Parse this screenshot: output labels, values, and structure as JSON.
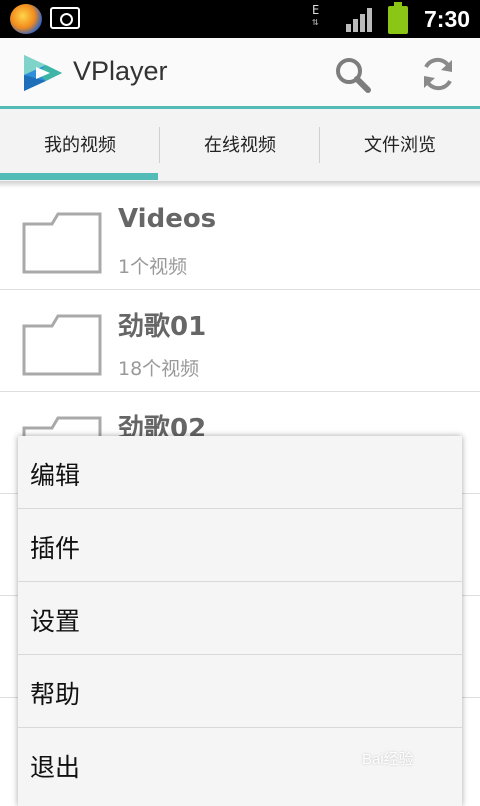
{
  "status_bar": {
    "network_type": "E",
    "time": "7:30",
    "signal_level": 4,
    "battery_level": 1.0,
    "icons": [
      "app-notification-icon",
      "camera-icon",
      "data-transfer-icon",
      "signal-icon",
      "battery-icon"
    ]
  },
  "action_bar": {
    "title": "VPlayer",
    "search_icon": "search-icon",
    "refresh_icon": "refresh-icon",
    "accent_color": "#53bcb6"
  },
  "tabs": [
    {
      "label": "我的视频",
      "selected": true
    },
    {
      "label": "在线视频",
      "selected": false
    },
    {
      "label": "文件浏览",
      "selected": false
    }
  ],
  "folders": [
    {
      "name": "Videos",
      "count": "1个视频"
    },
    {
      "name": "劲歌01",
      "count": "18个视频"
    },
    {
      "name": "劲歌02",
      "count": ""
    }
  ],
  "menu": {
    "items": [
      {
        "label": "编辑"
      },
      {
        "label": "插件"
      },
      {
        "label": "设置"
      },
      {
        "label": "帮助"
      },
      {
        "label": "退出"
      }
    ]
  },
  "watermark": "Bai经验"
}
